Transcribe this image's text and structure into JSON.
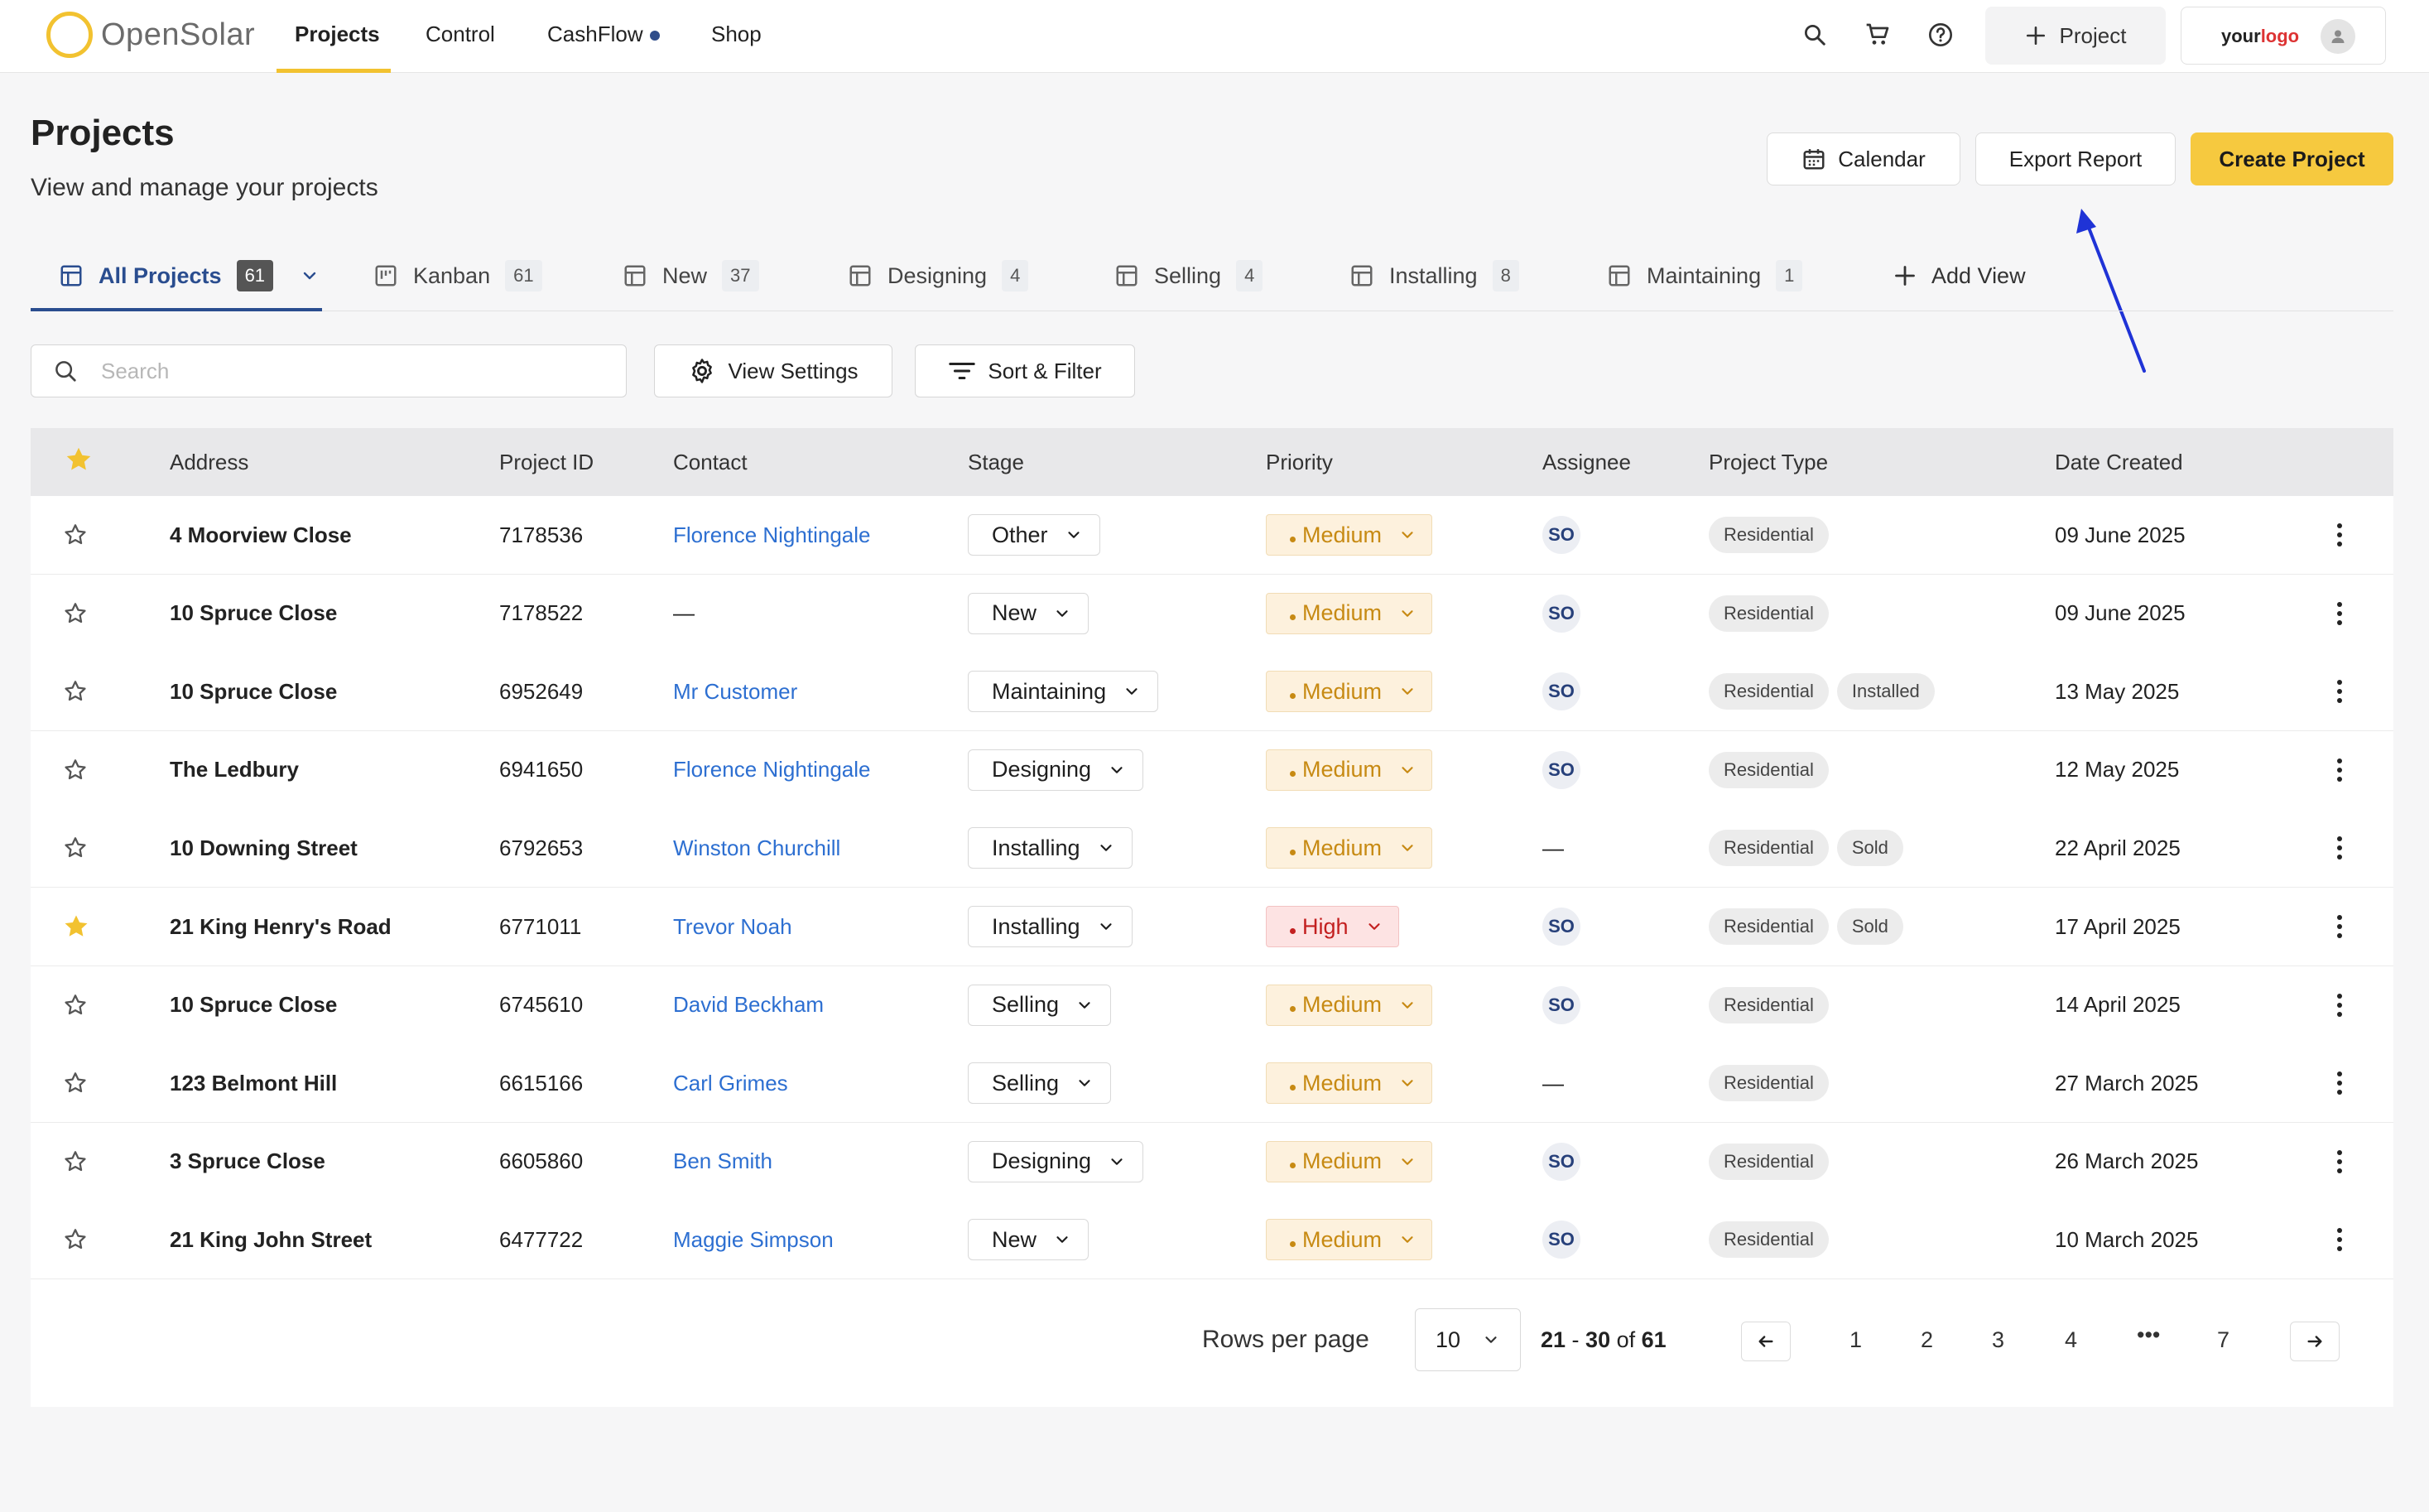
{
  "app": {
    "brand": "OpenSolar",
    "nav": [
      {
        "label": "Projects",
        "active": true
      },
      {
        "label": "Control"
      },
      {
        "label": "CashFlow",
        "dot_color": "#2f4d8a"
      },
      {
        "label": "Shop"
      }
    ],
    "top_icons": [
      "search-icon",
      "cart-icon",
      "help-icon"
    ],
    "project_button_label": "Project",
    "org_logo": {
      "prefix": "your",
      "suffix": "logo"
    }
  },
  "header": {
    "title": "Projects",
    "subtitle": "View and manage your projects",
    "calendar_label": "Calendar",
    "export_label": "Export Report",
    "create_label": "Create Project"
  },
  "tabs": [
    {
      "label": "All Projects",
      "count": "61",
      "active": true
    },
    {
      "label": "Kanban",
      "count": "61"
    },
    {
      "label": "New",
      "count": "37"
    },
    {
      "label": "Designing",
      "count": "4"
    },
    {
      "label": "Selling",
      "count": "4"
    },
    {
      "label": "Installing",
      "count": "8"
    },
    {
      "label": "Maintaining",
      "count": "1"
    }
  ],
  "add_view_label": "Add View",
  "toolbar": {
    "search_placeholder": "Search",
    "view_settings_label": "View Settings",
    "sort_filter_label": "Sort & Filter"
  },
  "table": {
    "columns": [
      "Address",
      "Project ID",
      "Contact",
      "Stage",
      "Priority",
      "Assignee",
      "Project Type",
      "Date Created"
    ],
    "rows": [
      {
        "starred": false,
        "address": "4 Moorview Close",
        "id": "7178536",
        "contact": "Florence Nightingale",
        "stage": "Other",
        "priority": "Medium",
        "assignee": "SO",
        "types": [
          "Residential"
        ],
        "date": "09 June 2025"
      },
      {
        "starred": false,
        "address": "10 Spruce Close",
        "id": "7178522",
        "contact": "—",
        "stage": "New",
        "priority": "Medium",
        "assignee": "SO",
        "types": [
          "Residential"
        ],
        "date": "09 June 2025"
      },
      {
        "starred": false,
        "address": "10 Spruce Close",
        "id": "6952649",
        "contact": "Mr Customer",
        "stage": "Maintaining",
        "priority": "Medium",
        "assignee": "SO",
        "types": [
          "Residential",
          "Installed"
        ],
        "date": "13 May 2025"
      },
      {
        "starred": false,
        "address": "The Ledbury",
        "id": "6941650",
        "contact": "Florence Nightingale",
        "stage": "Designing",
        "priority": "Medium",
        "assignee": "SO",
        "types": [
          "Residential"
        ],
        "date": "12 May 2025"
      },
      {
        "starred": false,
        "address": "10 Downing Street",
        "id": "6792653",
        "contact": "Winston Churchill",
        "stage": "Installing",
        "priority": "Medium",
        "assignee": "—",
        "types": [
          "Residential",
          "Sold"
        ],
        "date": "22 April 2025"
      },
      {
        "starred": true,
        "address": "21 King Henry's Road",
        "id": "6771011",
        "contact": "Trevor Noah",
        "stage": "Installing",
        "priority": "High",
        "assignee": "SO",
        "types": [
          "Residential",
          "Sold"
        ],
        "date": "17 April 2025"
      },
      {
        "starred": false,
        "address": "10 Spruce Close",
        "id": "6745610",
        "contact": "David Beckham",
        "stage": "Selling",
        "priority": "Medium",
        "assignee": "SO",
        "types": [
          "Residential"
        ],
        "date": "14 April 2025"
      },
      {
        "starred": false,
        "address": "123 Belmont Hill",
        "id": "6615166",
        "contact": "Carl Grimes",
        "stage": "Selling",
        "priority": "Medium",
        "assignee": "—",
        "types": [
          "Residential"
        ],
        "date": "27 March 2025"
      },
      {
        "starred": false,
        "address": "3 Spruce Close",
        "id": "6605860",
        "contact": "Ben Smith",
        "stage": "Designing",
        "priority": "Medium",
        "assignee": "SO",
        "types": [
          "Residential"
        ],
        "date": "26 March 2025"
      },
      {
        "starred": false,
        "address": "21 King John Street",
        "id": "6477722",
        "contact": "Maggie Simpson",
        "stage": "New",
        "priority": "Medium",
        "assignee": "SO",
        "types": [
          "Residential"
        ],
        "date": "10 March 2025"
      }
    ]
  },
  "pagination": {
    "rows_per_page_label": "Rows per page",
    "rows_per_page": "10",
    "range_start": "21",
    "range_end": "30",
    "range_of": "of",
    "total": "61",
    "pages": [
      "1",
      "2",
      "3",
      "4",
      "•••",
      "7"
    ]
  },
  "colors": {
    "accent": "#f6c93f",
    "link": "#2d6fd1",
    "active_tab": "#2a4d8f",
    "annotation_arrow": "#1f33d6"
  }
}
